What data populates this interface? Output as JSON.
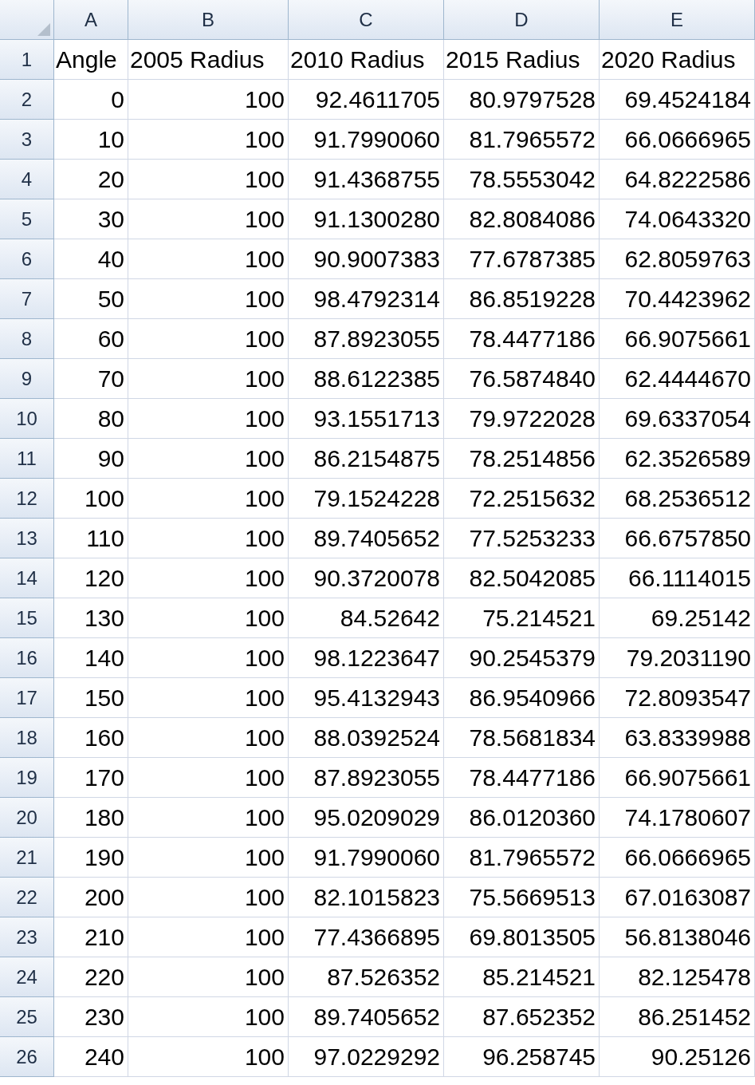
{
  "columns": [
    "A",
    "B",
    "C",
    "D",
    "E"
  ],
  "rows": [
    {
      "number": "1",
      "kind": "header",
      "cells": [
        "Angle",
        "2005 Radius",
        "2010 Radius",
        "2015 Radius",
        "2020 Radius"
      ]
    },
    {
      "number": "2",
      "kind": "data",
      "cells": [
        "0",
        "100",
        "92.4611705",
        "80.9797528",
        "69.4524184"
      ]
    },
    {
      "number": "3",
      "kind": "data",
      "cells": [
        "10",
        "100",
        "91.7990060",
        "81.7965572",
        "66.0666965"
      ]
    },
    {
      "number": "4",
      "kind": "data",
      "cells": [
        "20",
        "100",
        "91.4368755",
        "78.5553042",
        "64.8222586"
      ]
    },
    {
      "number": "5",
      "kind": "data",
      "cells": [
        "30",
        "100",
        "91.1300280",
        "82.8084086",
        "74.0643320"
      ]
    },
    {
      "number": "6",
      "kind": "data",
      "cells": [
        "40",
        "100",
        "90.9007383",
        "77.6787385",
        "62.8059763"
      ]
    },
    {
      "number": "7",
      "kind": "data",
      "cells": [
        "50",
        "100",
        "98.4792314",
        "86.8519228",
        "70.4423962"
      ]
    },
    {
      "number": "8",
      "kind": "data",
      "cells": [
        "60",
        "100",
        "87.8923055",
        "78.4477186",
        "66.9075661"
      ]
    },
    {
      "number": "9",
      "kind": "data",
      "cells": [
        "70",
        "100",
        "88.6122385",
        "76.5874840",
        "62.4444670"
      ]
    },
    {
      "number": "10",
      "kind": "data",
      "cells": [
        "80",
        "100",
        "93.1551713",
        "79.9722028",
        "69.6337054"
      ]
    },
    {
      "number": "11",
      "kind": "data",
      "cells": [
        "90",
        "100",
        "86.2154875",
        "78.2514856",
        "62.3526589"
      ]
    },
    {
      "number": "12",
      "kind": "data",
      "cells": [
        "100",
        "100",
        "79.1524228",
        "72.2515632",
        "68.2536512"
      ]
    },
    {
      "number": "13",
      "kind": "data",
      "cells": [
        "110",
        "100",
        "89.7405652",
        "77.5253233",
        "66.6757850"
      ]
    },
    {
      "number": "14",
      "kind": "data",
      "cells": [
        "120",
        "100",
        "90.3720078",
        "82.5042085",
        "66.1114015"
      ]
    },
    {
      "number": "15",
      "kind": "data",
      "cells": [
        "130",
        "100",
        "84.52642",
        "75.214521",
        "69.25142"
      ]
    },
    {
      "number": "16",
      "kind": "data",
      "cells": [
        "140",
        "100",
        "98.1223647",
        "90.2545379",
        "79.2031190"
      ]
    },
    {
      "number": "17",
      "kind": "data",
      "cells": [
        "150",
        "100",
        "95.4132943",
        "86.9540966",
        "72.8093547"
      ]
    },
    {
      "number": "18",
      "kind": "data",
      "cells": [
        "160",
        "100",
        "88.0392524",
        "78.5681834",
        "63.8339988"
      ]
    },
    {
      "number": "19",
      "kind": "data",
      "cells": [
        "170",
        "100",
        "87.8923055",
        "78.4477186",
        "66.9075661"
      ]
    },
    {
      "number": "20",
      "kind": "data",
      "cells": [
        "180",
        "100",
        "95.0209029",
        "86.0120360",
        "74.1780607"
      ]
    },
    {
      "number": "21",
      "kind": "data",
      "cells": [
        "190",
        "100",
        "91.7990060",
        "81.7965572",
        "66.0666965"
      ]
    },
    {
      "number": "22",
      "kind": "data",
      "cells": [
        "200",
        "100",
        "82.1015823",
        "75.5669513",
        "67.0163087"
      ]
    },
    {
      "number": "23",
      "kind": "data",
      "cells": [
        "210",
        "100",
        "77.4366895",
        "69.8013505",
        "56.8138046"
      ]
    },
    {
      "number": "24",
      "kind": "data",
      "cells": [
        "220",
        "100",
        "87.526352",
        "85.214521",
        "82.125478"
      ]
    },
    {
      "number": "25",
      "kind": "data",
      "cells": [
        "230",
        "100",
        "89.7405652",
        "87.652352",
        "86.251452"
      ]
    },
    {
      "number": "26",
      "kind": "data",
      "cells": [
        "240",
        "100",
        "97.0229292",
        "96.258745",
        "90.25126"
      ]
    }
  ]
}
